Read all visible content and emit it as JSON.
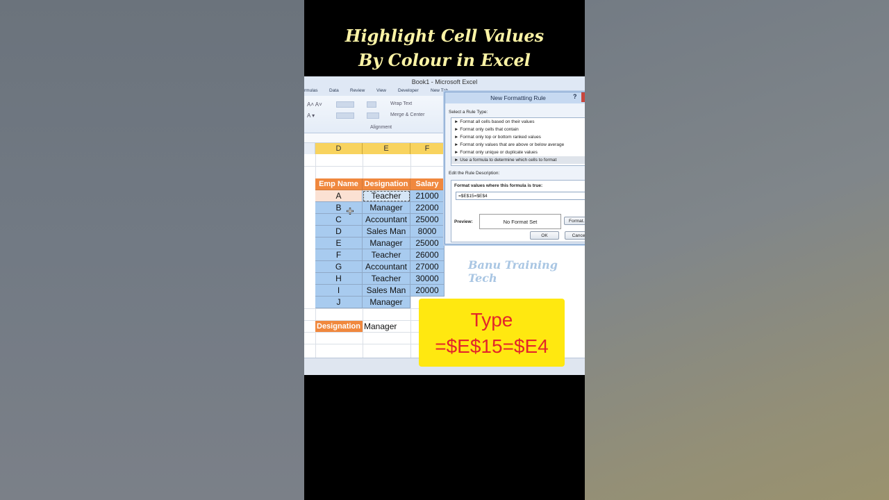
{
  "overlay": {
    "title_line1": "Highlight Cell Values",
    "title_line2": "By Colour in Excel",
    "watermark": "Banu Training Tech",
    "callout_line1": "Type",
    "callout_line2": "=$E$15=$E4"
  },
  "window": {
    "title": "Book1 - Microsoft Excel"
  },
  "ribbon": {
    "tabs": [
      "rmulas",
      "Data",
      "Review",
      "View",
      "Developer",
      "New Tab"
    ],
    "wrap_text": "Wrap Text",
    "merge_center": "Merge & Center",
    "group_alignment": "Alignment"
  },
  "columns": [
    "D",
    "E",
    "F"
  ],
  "table": {
    "headers": [
      "Emp Name",
      "Designation",
      "Salary"
    ],
    "rows": [
      [
        "A",
        "Teacher",
        "21000"
      ],
      [
        "B",
        "Manager",
        "22000"
      ],
      [
        "C",
        "Accountant",
        "25000"
      ],
      [
        "D",
        "Sales Man",
        "8000"
      ],
      [
        "E",
        "Manager",
        "25000"
      ],
      [
        "F",
        "Teacher",
        "26000"
      ],
      [
        "G",
        "Accountant",
        "27000"
      ],
      [
        "H",
        "Teacher",
        "30000"
      ],
      [
        "I",
        "Sales Man",
        "20000"
      ],
      [
        "J",
        "Manager",
        ""
      ]
    ]
  },
  "criteria": {
    "label": "Designation",
    "value": "Manager"
  },
  "dialog": {
    "title": "New Formatting Rule",
    "help": "?",
    "select_rule_type_label": "Select a Rule Type:",
    "rule_types": [
      "► Format all cells based on their values",
      "► Format only cells that contain",
      "► Format only top or bottom ranked values",
      "► Format only values that are above or below average",
      "► Format only unique or duplicate values",
      "► Use a formula to determine which cells to format"
    ],
    "selected_rule_index": 5,
    "edit_description_label": "Edit the Rule Description:",
    "formula_label": "Format values where this formula is true:",
    "formula_value": "=$E$15=$E$4",
    "preview_label": "Preview:",
    "preview_text": "No Format Set",
    "format_button": "Format...",
    "ok_button": "OK",
    "cancel_button": "Cance"
  }
}
